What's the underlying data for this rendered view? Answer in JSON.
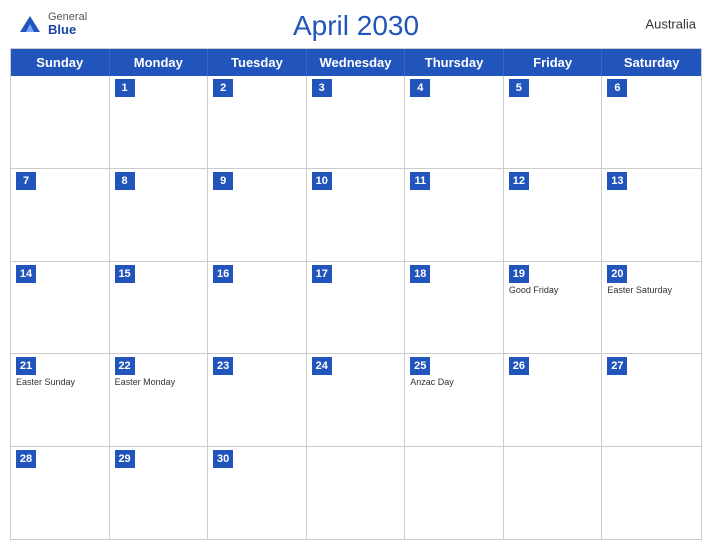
{
  "header": {
    "title": "April 2030",
    "country": "Australia",
    "logo_general": "General",
    "logo_blue": "Blue"
  },
  "days_of_week": [
    "Sunday",
    "Monday",
    "Tuesday",
    "Wednesday",
    "Thursday",
    "Friday",
    "Saturday"
  ],
  "weeks": [
    [
      {
        "day": "",
        "events": []
      },
      {
        "day": "1",
        "events": []
      },
      {
        "day": "2",
        "events": []
      },
      {
        "day": "3",
        "events": []
      },
      {
        "day": "4",
        "events": []
      },
      {
        "day": "5",
        "events": []
      },
      {
        "day": "6",
        "events": []
      }
    ],
    [
      {
        "day": "7",
        "events": []
      },
      {
        "day": "8",
        "events": []
      },
      {
        "day": "9",
        "events": []
      },
      {
        "day": "10",
        "events": []
      },
      {
        "day": "11",
        "events": []
      },
      {
        "day": "12",
        "events": []
      },
      {
        "day": "13",
        "events": []
      }
    ],
    [
      {
        "day": "14",
        "events": []
      },
      {
        "day": "15",
        "events": []
      },
      {
        "day": "16",
        "events": []
      },
      {
        "day": "17",
        "events": []
      },
      {
        "day": "18",
        "events": []
      },
      {
        "day": "19",
        "events": [
          "Good Friday"
        ]
      },
      {
        "day": "20",
        "events": [
          "Easter Saturday"
        ]
      }
    ],
    [
      {
        "day": "21",
        "events": [
          "Easter Sunday"
        ]
      },
      {
        "day": "22",
        "events": [
          "Easter Monday"
        ]
      },
      {
        "day": "23",
        "events": []
      },
      {
        "day": "24",
        "events": []
      },
      {
        "day": "25",
        "events": [
          "Anzac Day"
        ]
      },
      {
        "day": "26",
        "events": []
      },
      {
        "day": "27",
        "events": []
      }
    ],
    [
      {
        "day": "28",
        "events": []
      },
      {
        "day": "29",
        "events": []
      },
      {
        "day": "30",
        "events": []
      },
      {
        "day": "",
        "events": []
      },
      {
        "day": "",
        "events": []
      },
      {
        "day": "",
        "events": []
      },
      {
        "day": "",
        "events": []
      }
    ]
  ]
}
